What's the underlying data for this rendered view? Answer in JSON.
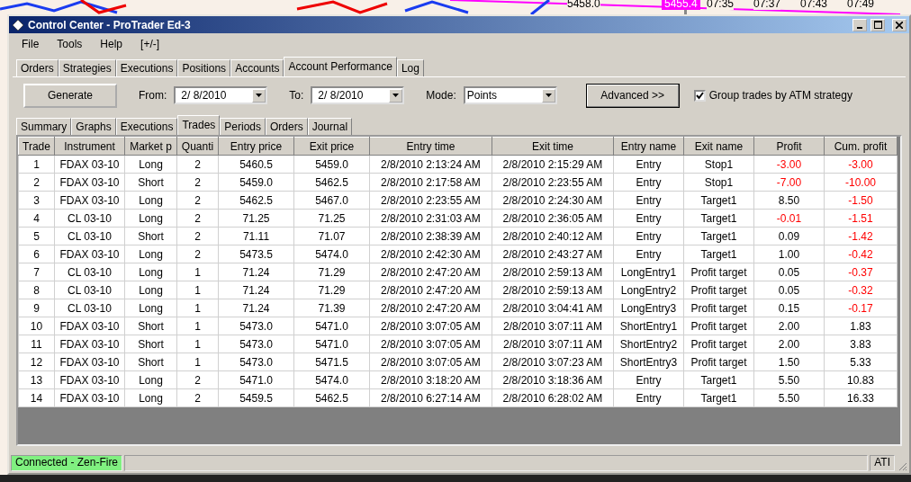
{
  "background": {
    "price_labels": [
      {
        "text": "5458.0",
        "kind": "plain"
      },
      {
        "text": "5455.4",
        "kind": "tag"
      }
    ],
    "time_labels": [
      "07:35",
      "07:37",
      "07:43",
      "07:49"
    ]
  },
  "window": {
    "title": "Control Center - ProTrader Ed-3"
  },
  "menu": [
    "File",
    "Tools",
    "Help",
    "[+/-]"
  ],
  "tabs": [
    {
      "label": "Orders",
      "selected": false
    },
    {
      "label": "Strategies",
      "selected": false
    },
    {
      "label": "Executions",
      "selected": false
    },
    {
      "label": "Positions",
      "selected": false
    },
    {
      "label": "Accounts",
      "selected": false
    },
    {
      "label": "Account Performance",
      "selected": true
    },
    {
      "label": "Log",
      "selected": false
    }
  ],
  "toolbar": {
    "generate": "Generate",
    "from_label": "From:",
    "from_value": "2/  8/2010",
    "to_label": "To:",
    "to_value": "2/  8/2010",
    "mode_label": "Mode:",
    "mode_value": "Points",
    "advanced": "Advanced >>",
    "group_label": "Group trades by ATM strategy",
    "group_checked": true
  },
  "subtabs": [
    {
      "label": "Summary",
      "selected": false
    },
    {
      "label": "Graphs",
      "selected": false
    },
    {
      "label": "Executions",
      "selected": false
    },
    {
      "label": "Trades",
      "selected": true
    },
    {
      "label": "Periods",
      "selected": false
    },
    {
      "label": "Orders",
      "selected": false
    },
    {
      "label": "Journal",
      "selected": false
    }
  ],
  "table": {
    "columns": [
      "Trade",
      "Instrument",
      "Market p",
      "Quanti",
      "Entry price",
      "Exit price",
      "Entry time",
      "Exit time",
      "Entry name",
      "Exit name",
      "Profit",
      "Cum. profit"
    ],
    "rows": [
      {
        "cells": [
          "1",
          "FDAX 03-10",
          "Long",
          "2",
          "5460.5",
          "5459.0",
          "2/8/2010 2:13:24 AM",
          "2/8/2010 2:15:29 AM",
          "Entry",
          "Stop1",
          "-3.00",
          "-3.00"
        ],
        "profit_negative": true,
        "cum_negative": true
      },
      {
        "cells": [
          "2",
          "FDAX 03-10",
          "Short",
          "2",
          "5459.0",
          "5462.5",
          "2/8/2010 2:17:58 AM",
          "2/8/2010 2:23:55 AM",
          "Entry",
          "Stop1",
          "-7.00",
          "-10.00"
        ],
        "profit_negative": true,
        "cum_negative": true
      },
      {
        "cells": [
          "3",
          "FDAX 03-10",
          "Long",
          "2",
          "5462.5",
          "5467.0",
          "2/8/2010 2:23:55 AM",
          "2/8/2010 2:24:30 AM",
          "Entry",
          "Target1",
          "8.50",
          "-1.50"
        ],
        "profit_negative": false,
        "cum_negative": true
      },
      {
        "cells": [
          "4",
          "CL 03-10",
          "Long",
          "2",
          "71.25",
          "71.25",
          "2/8/2010 2:31:03 AM",
          "2/8/2010 2:36:05 AM",
          "Entry",
          "Target1",
          "-0.01",
          "-1.51"
        ],
        "profit_negative": true,
        "cum_negative": true
      },
      {
        "cells": [
          "5",
          "CL 03-10",
          "Short",
          "2",
          "71.11",
          "71.07",
          "2/8/2010 2:38:39 AM",
          "2/8/2010 2:40:12 AM",
          "Entry",
          "Target1",
          "0.09",
          "-1.42"
        ],
        "profit_negative": false,
        "cum_negative": true
      },
      {
        "cells": [
          "6",
          "FDAX 03-10",
          "Long",
          "2",
          "5473.5",
          "5474.0",
          "2/8/2010 2:42:30 AM",
          "2/8/2010 2:43:27 AM",
          "Entry",
          "Target1",
          "1.00",
          "-0.42"
        ],
        "profit_negative": false,
        "cum_negative": true
      },
      {
        "cells": [
          "7",
          "CL 03-10",
          "Long",
          "1",
          "71.24",
          "71.29",
          "2/8/2010 2:47:20 AM",
          "2/8/2010 2:59:13 AM",
          "LongEntry1",
          "Profit target",
          "0.05",
          "-0.37"
        ],
        "profit_negative": false,
        "cum_negative": true
      },
      {
        "cells": [
          "8",
          "CL 03-10",
          "Long",
          "1",
          "71.24",
          "71.29",
          "2/8/2010 2:47:20 AM",
          "2/8/2010 2:59:13 AM",
          "LongEntry2",
          "Profit target",
          "0.05",
          "-0.32"
        ],
        "profit_negative": false,
        "cum_negative": true
      },
      {
        "cells": [
          "9",
          "CL 03-10",
          "Long",
          "1",
          "71.24",
          "71.39",
          "2/8/2010 2:47:20 AM",
          "2/8/2010 3:04:41 AM",
          "LongEntry3",
          "Profit target",
          "0.15",
          "-0.17"
        ],
        "profit_negative": false,
        "cum_negative": true
      },
      {
        "cells": [
          "10",
          "FDAX 03-10",
          "Short",
          "1",
          "5473.0",
          "5471.0",
          "2/8/2010 3:07:05 AM",
          "2/8/2010 3:07:11 AM",
          "ShortEntry1",
          "Profit target",
          "2.00",
          "1.83"
        ],
        "profit_negative": false,
        "cum_negative": false
      },
      {
        "cells": [
          "11",
          "FDAX 03-10",
          "Short",
          "1",
          "5473.0",
          "5471.0",
          "2/8/2010 3:07:05 AM",
          "2/8/2010 3:07:11 AM",
          "ShortEntry2",
          "Profit target",
          "2.00",
          "3.83"
        ],
        "profit_negative": false,
        "cum_negative": false
      },
      {
        "cells": [
          "12",
          "FDAX 03-10",
          "Short",
          "1",
          "5473.0",
          "5471.5",
          "2/8/2010 3:07:05 AM",
          "2/8/2010 3:07:23 AM",
          "ShortEntry3",
          "Profit target",
          "1.50",
          "5.33"
        ],
        "profit_negative": false,
        "cum_negative": false
      },
      {
        "cells": [
          "13",
          "FDAX 03-10",
          "Long",
          "2",
          "5471.0",
          "5474.0",
          "2/8/2010 3:18:20 AM",
          "2/8/2010 3:18:36 AM",
          "Entry",
          "Target1",
          "5.50",
          "10.83"
        ],
        "profit_negative": false,
        "cum_negative": false
      },
      {
        "cells": [
          "14",
          "FDAX 03-10",
          "Long",
          "2",
          "5459.5",
          "5462.5",
          "2/8/2010 6:27:14 AM",
          "2/8/2010 6:28:02 AM",
          "Entry",
          "Target1",
          "5.50",
          "16.33"
        ],
        "profit_negative": false,
        "cum_negative": false
      }
    ]
  },
  "status_bar": {
    "connection": "Connected - Zen-Fire",
    "right": "ATI"
  }
}
